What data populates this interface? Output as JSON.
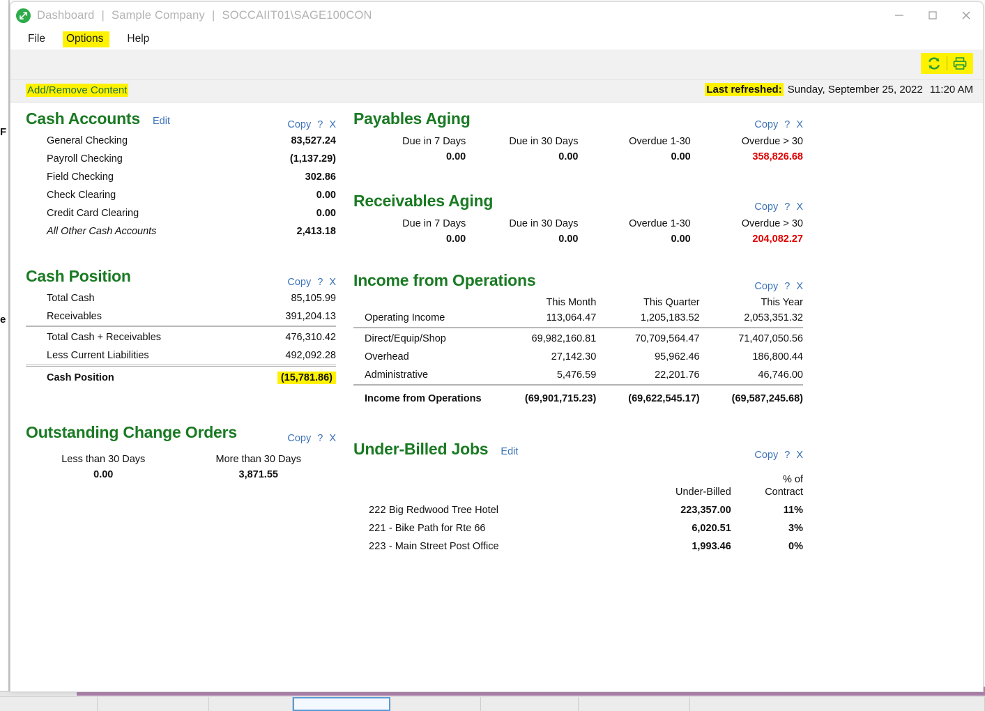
{
  "window": {
    "title_app": "Dashboard",
    "title_company": "Sample Company",
    "title_server": "SOCCAIIT01\\SAGE100CON",
    "separator": "|",
    "minimize_label": "Minimize",
    "maximize_label": "Maximize",
    "close_label": "Close"
  },
  "menu": {
    "items": [
      {
        "label": "File",
        "highlighted": false
      },
      {
        "label": "Options",
        "highlighted": true
      },
      {
        "label": "Help",
        "highlighted": false
      }
    ]
  },
  "toolbar": {
    "refresh_icon": "refresh-icon",
    "print_icon": "printer-icon"
  },
  "subbar": {
    "add_remove_label": "Add/Remove Content",
    "last_refreshed_label": "Last refreshed:",
    "last_refreshed_date": "Sunday, September 25, 2022",
    "last_refreshed_time": "11:20 AM"
  },
  "actions": {
    "edit": "Edit",
    "copy": "Copy",
    "help": "?",
    "close": "X"
  },
  "widgets": {
    "cash_accounts": {
      "title": "Cash Accounts",
      "has_edit": true,
      "rows": [
        {
          "label": "General Checking",
          "value": "83,527.24"
        },
        {
          "label": "Payroll Checking",
          "value": "(1,137.29)"
        },
        {
          "label": "Field Checking",
          "value": "302.86"
        },
        {
          "label": "Check Clearing",
          "value": "0.00"
        },
        {
          "label": "Credit Card Clearing",
          "value": "0.00"
        },
        {
          "label": "All Other Cash Accounts",
          "value": "2,413.18",
          "italic": true
        }
      ]
    },
    "cash_position": {
      "title": "Cash Position",
      "rows": [
        {
          "label": "Total Cash",
          "value": "85,105.99"
        },
        {
          "label": "Receivables",
          "value": "391,204.13"
        },
        {
          "label": "Total Cash + Receivables",
          "value": "476,310.42",
          "rule": "top"
        },
        {
          "label": "Less Current Liabilities",
          "value": "492,092.28"
        },
        {
          "label": "Cash Position",
          "value": "(15,781.86)",
          "rule": "double",
          "total": true,
          "highlight": "yellow"
        }
      ]
    },
    "outstanding_change_orders": {
      "title": "Outstanding Change Orders",
      "columns": [
        "Less than 30 Days",
        "More than 30 Days"
      ],
      "values": [
        "0.00",
        "3,871.55"
      ],
      "value_styles": [
        "",
        "yellow-red"
      ]
    },
    "payables_aging": {
      "title": "Payables Aging",
      "columns": [
        "Due in 7 Days",
        "Due in 30 Days",
        "Overdue 1-30",
        "Overdue > 30"
      ],
      "values": [
        "0.00",
        "0.00",
        "0.00",
        "358,826.68"
      ],
      "value_styles": [
        "",
        "",
        "",
        "red"
      ]
    },
    "receivables_aging": {
      "title": "Receivables Aging",
      "columns": [
        "Due in 7 Days",
        "Due in 30 Days",
        "Overdue 1-30",
        "Overdue > 30"
      ],
      "values": [
        "0.00",
        "0.00",
        "0.00",
        "204,082.27"
      ],
      "value_styles": [
        "",
        "",
        "",
        "red"
      ]
    },
    "income_from_operations": {
      "title": "Income from Operations",
      "columns": [
        "This Month",
        "This Quarter",
        "This Year"
      ],
      "rows": [
        {
          "label": "Operating Income",
          "values": [
            "113,064.47",
            "1,205,183.52",
            "2,053,351.32"
          ]
        },
        {
          "label": "Direct/Equip/Shop",
          "values": [
            "69,982,160.81",
            "70,709,564.47",
            "71,407,050.56"
          ],
          "rule": "top"
        },
        {
          "label": "Overhead",
          "values": [
            "27,142.30",
            "95,962.46",
            "186,800.44"
          ]
        },
        {
          "label": "Administrative",
          "values": [
            "5,476.59",
            "22,201.76",
            "46,746.00"
          ]
        },
        {
          "label": "Income from Operations",
          "values": [
            "(69,901,715.23)",
            "(69,622,545.17)",
            "(69,587,245.68)"
          ],
          "rule": "double",
          "total": true
        }
      ]
    },
    "under_billed_jobs": {
      "title": "Under-Billed Jobs",
      "has_edit": true,
      "columns": [
        "",
        "Under-Billed",
        "% of\nContract"
      ],
      "column_underbilled": "Under-Billed",
      "column_pct_line1": "% of",
      "column_pct_line2": "Contract",
      "rows": [
        {
          "job_number": "222",
          "job_sep": "",
          "job_name": "Big Redwood Tree Hotel",
          "under_billed": "223,357.00",
          "pct": "11%"
        },
        {
          "job_number": "221",
          "job_sep": "-",
          "job_name": "Bike Path for Rte 66",
          "under_billed": "6,020.51",
          "pct": "3%"
        },
        {
          "job_number": "223",
          "job_sep": "-",
          "job_name": "Main Street Post Office",
          "under_billed": "1,993.46",
          "pct": "0%"
        }
      ]
    }
  },
  "colors": {
    "widget_title_green": "#1a7a23",
    "link_blue": "#3b72b8",
    "highlight_yellow": "#fff200",
    "negative_red": "#e00000",
    "title_grey": "#b3b3b3"
  },
  "background": {
    "fragment_1": "F",
    "fragment_2": "e"
  }
}
